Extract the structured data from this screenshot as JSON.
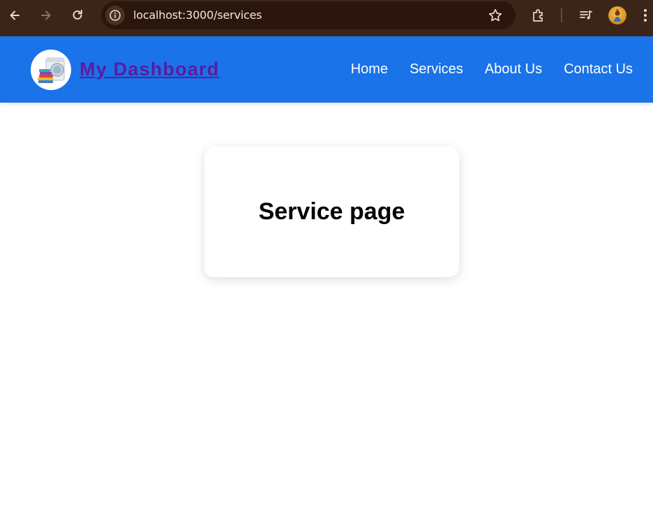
{
  "browser": {
    "url": "localhost:3000/services",
    "icons": [
      "back-arrow-icon",
      "forward-arrow-icon",
      "reload-icon",
      "site-info-icon",
      "bookmark-star-icon",
      "extensions-icon",
      "media-queue-icon",
      "profile-avatar",
      "kebab-menu-icon"
    ],
    "colors": {
      "frame": "#3b2418",
      "omnibox": "#2a160d"
    }
  },
  "header": {
    "brand": "My Dashboard",
    "nav": {
      "home": "Home",
      "services": "Services",
      "about": "About Us",
      "contact": "Contact Us"
    },
    "colors": {
      "background": "#1a73e8",
      "brand_text": "#5a1ca0",
      "nav_text": "#ffffff"
    }
  },
  "main": {
    "card_title": "Service page"
  }
}
